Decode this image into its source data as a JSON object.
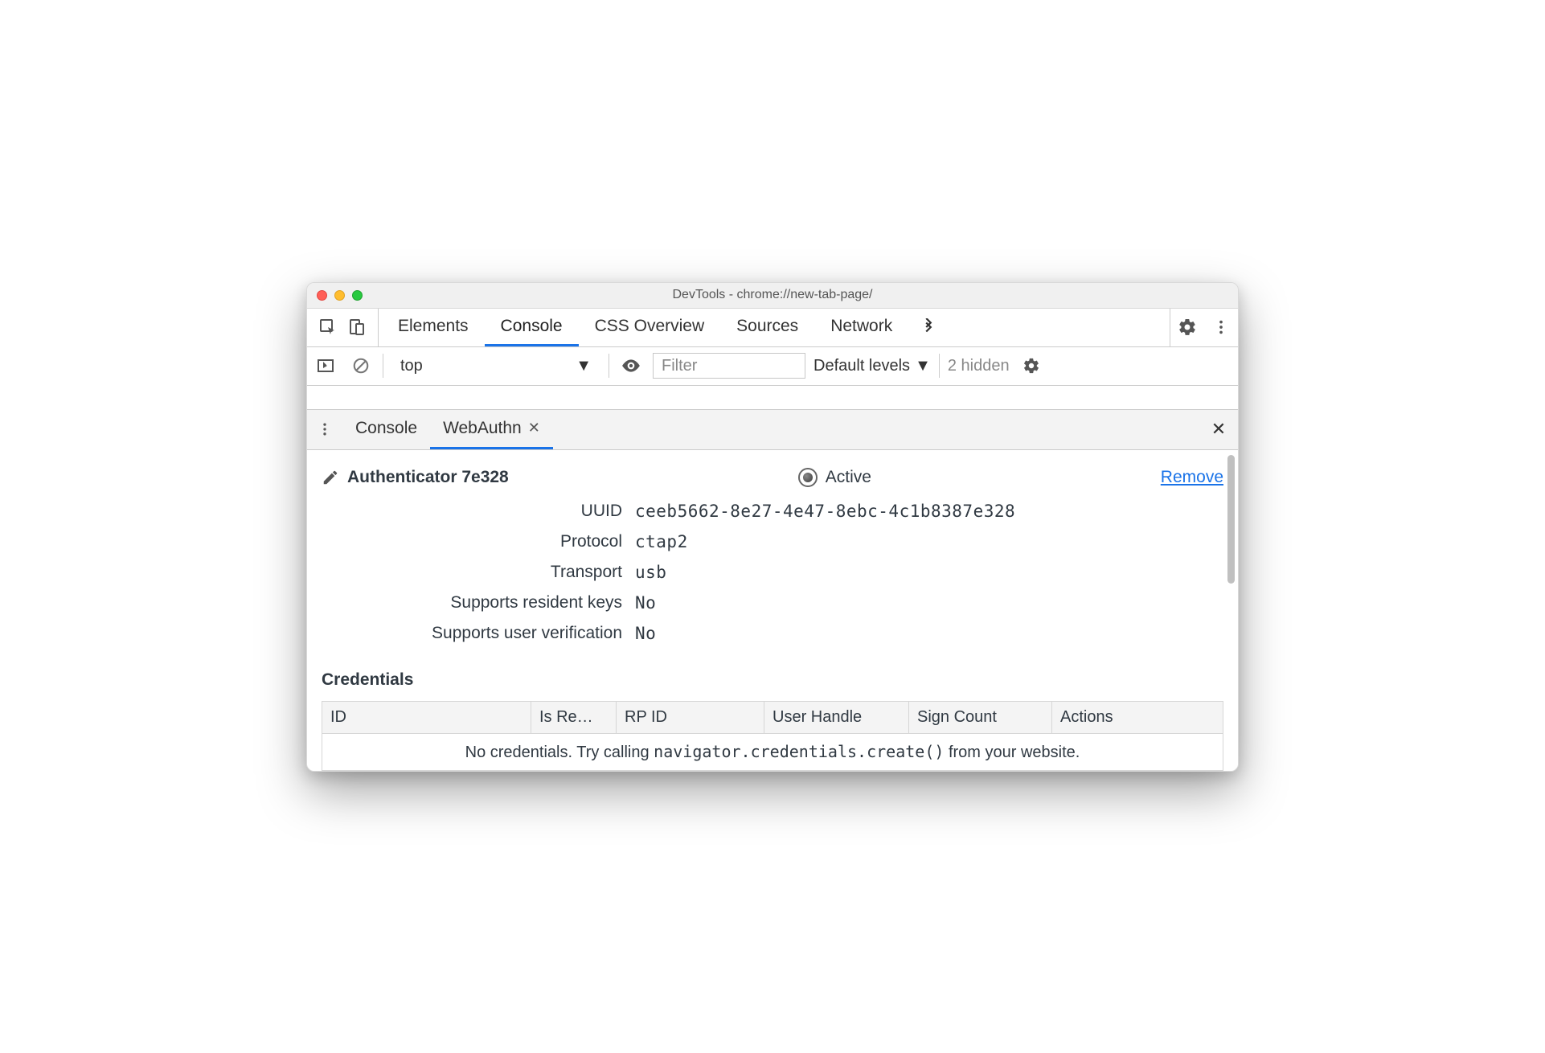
{
  "window": {
    "title": "DevTools - chrome://new-tab-page/"
  },
  "main_tabs": {
    "items": [
      "Elements",
      "Console",
      "CSS Overview",
      "Sources",
      "Network"
    ],
    "active_index": 1
  },
  "console_bar": {
    "context": "top",
    "filter_placeholder": "Filter",
    "levels_label": "Default levels",
    "hidden_label": "2 hidden"
  },
  "drawer": {
    "tabs": [
      "Console",
      "WebAuthn"
    ],
    "active_index": 1
  },
  "authenticator": {
    "name": "Authenticator 7e328",
    "active_label": "Active",
    "remove_label": "Remove",
    "rows": {
      "uuid_label": "UUID",
      "uuid_value": "ceeb5662-8e27-4e47-8ebc-4c1b8387e328",
      "protocol_label": "Protocol",
      "protocol_value": "ctap2",
      "transport_label": "Transport",
      "transport_value": "usb",
      "resident_label": "Supports resident keys",
      "resident_value": "No",
      "uv_label": "Supports user verification",
      "uv_value": "No"
    }
  },
  "credentials": {
    "title": "Credentials",
    "columns": [
      "ID",
      "Is Re…",
      "RP ID",
      "User Handle",
      "Sign Count",
      "Actions"
    ],
    "empty_prefix": "No credentials. Try calling ",
    "empty_code": "navigator.credentials.create()",
    "empty_suffix": " from your website."
  }
}
